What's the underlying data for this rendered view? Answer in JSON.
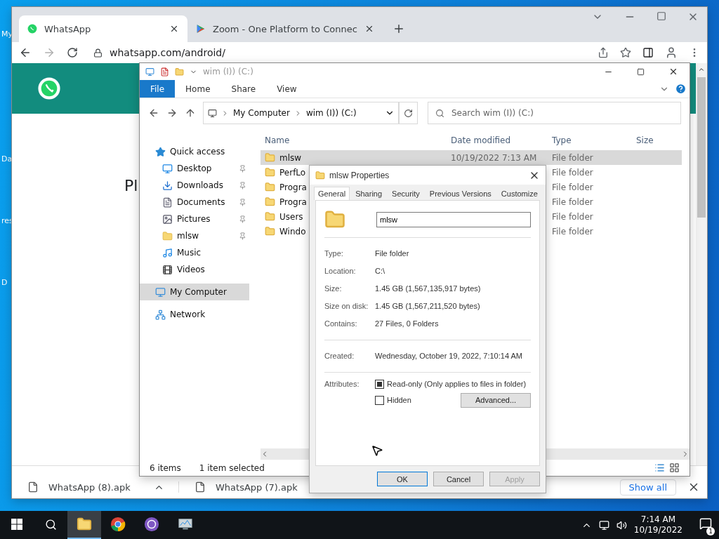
{
  "desktop": {
    "labels": [
      "My",
      "Da",
      "res",
      "D"
    ]
  },
  "browser": {
    "tabs": [
      {
        "title": "WhatsApp",
        "selected": true
      },
      {
        "title": "Zoom - One Platform to Connec",
        "selected": false
      }
    ],
    "url": "whatsapp.com/android/",
    "page": {
      "heading": "Pl"
    },
    "downloads": [
      {
        "file": "WhatsApp (8).apk"
      },
      {
        "file": "WhatsApp (7).apk"
      }
    ],
    "show_all": "Show all"
  },
  "explorer": {
    "title": "wim (I)) (C:)",
    "ribbon_tabs": [
      {
        "label": "File",
        "selected": true
      },
      {
        "label": "Home",
        "selected": false
      },
      {
        "label": "Share",
        "selected": false
      },
      {
        "label": "View",
        "selected": false
      }
    ],
    "breadcrumbs": [
      "My Computer",
      "wim (I)) (C:)"
    ],
    "search": {
      "placeholder": "Search wim (I)) (C:)"
    },
    "nav": [
      {
        "label": "Quick access",
        "selected": false,
        "children": [
          {
            "label": "Desktop",
            "selected": false,
            "pinned": true
          },
          {
            "label": "Downloads",
            "selected": false,
            "pinned": true
          },
          {
            "label": "Documents",
            "selected": false,
            "pinned": true
          },
          {
            "label": "Pictures",
            "selected": false,
            "pinned": true
          },
          {
            "label": "mlsw",
            "selected": false,
            "pinned": true
          },
          {
            "label": "Music",
            "selected": false,
            "pinned": false
          },
          {
            "label": "Videos",
            "selected": false,
            "pinned": false
          }
        ]
      },
      {
        "label": "My Computer",
        "selected": true
      },
      {
        "label": "Network",
        "selected": false
      }
    ],
    "columns": [
      "Name",
      "Date modified",
      "Type",
      "Size"
    ],
    "files": [
      {
        "name": "mlsw",
        "date": "10/19/2022 7:13 AM",
        "type": "File folder",
        "selected": true
      },
      {
        "name": "PerfLo",
        "type": "File folder",
        "selected": false
      },
      {
        "name": "Progra",
        "type": "File folder",
        "selected": false
      },
      {
        "name": "Progra",
        "type": "File folder",
        "selected": false
      },
      {
        "name": "Users",
        "type": "File folder",
        "selected": false
      },
      {
        "name": "Windo",
        "type": "File folder",
        "selected": false
      }
    ],
    "status": {
      "count": "6 items",
      "selection": "1 item selected"
    }
  },
  "properties": {
    "title": "mlsw Properties",
    "tabs": [
      {
        "label": "General",
        "selected": true
      },
      {
        "label": "Sharing",
        "selected": false
      },
      {
        "label": "Security",
        "selected": false
      },
      {
        "label": "Previous Versions",
        "selected": false
      },
      {
        "label": "Customize",
        "selected": false
      }
    ],
    "name": "mlsw",
    "sections": [
      {
        "rows": [
          {
            "label": "Type:",
            "value": "File folder"
          },
          {
            "label": "Location:",
            "value": "C:\\"
          },
          {
            "label": "Size:",
            "value": "1.45 GB (1,567,135,917 bytes)"
          },
          {
            "label": "Size on disk:",
            "value": "1.45 GB (1,567,211,520 bytes)"
          },
          {
            "label": "Contains:",
            "value": "27 Files, 0 Folders"
          }
        ]
      },
      {
        "rows": [
          {
            "label": "Created:",
            "value": "Wednesday, October 19, 2022, 7:10:14 AM"
          }
        ]
      }
    ],
    "attributes_label": "Attributes:",
    "attributes": [
      {
        "label": "Read-only (Only applies to files in folder)",
        "checked": true
      },
      {
        "label": "Hidden",
        "checked": false
      }
    ],
    "advanced": "Advanced...",
    "buttons": [
      {
        "label": "OK",
        "disabled": false
      },
      {
        "label": "Cancel",
        "disabled": false
      },
      {
        "label": "Apply",
        "disabled": true
      }
    ]
  },
  "taskbar": {
    "apps": [
      {
        "selected": true
      },
      {
        "selected": false
      },
      {
        "selected": false
      },
      {
        "selected": false
      }
    ],
    "time": "7:14 AM",
    "date": "10/19/2022",
    "notifications": "1"
  }
}
